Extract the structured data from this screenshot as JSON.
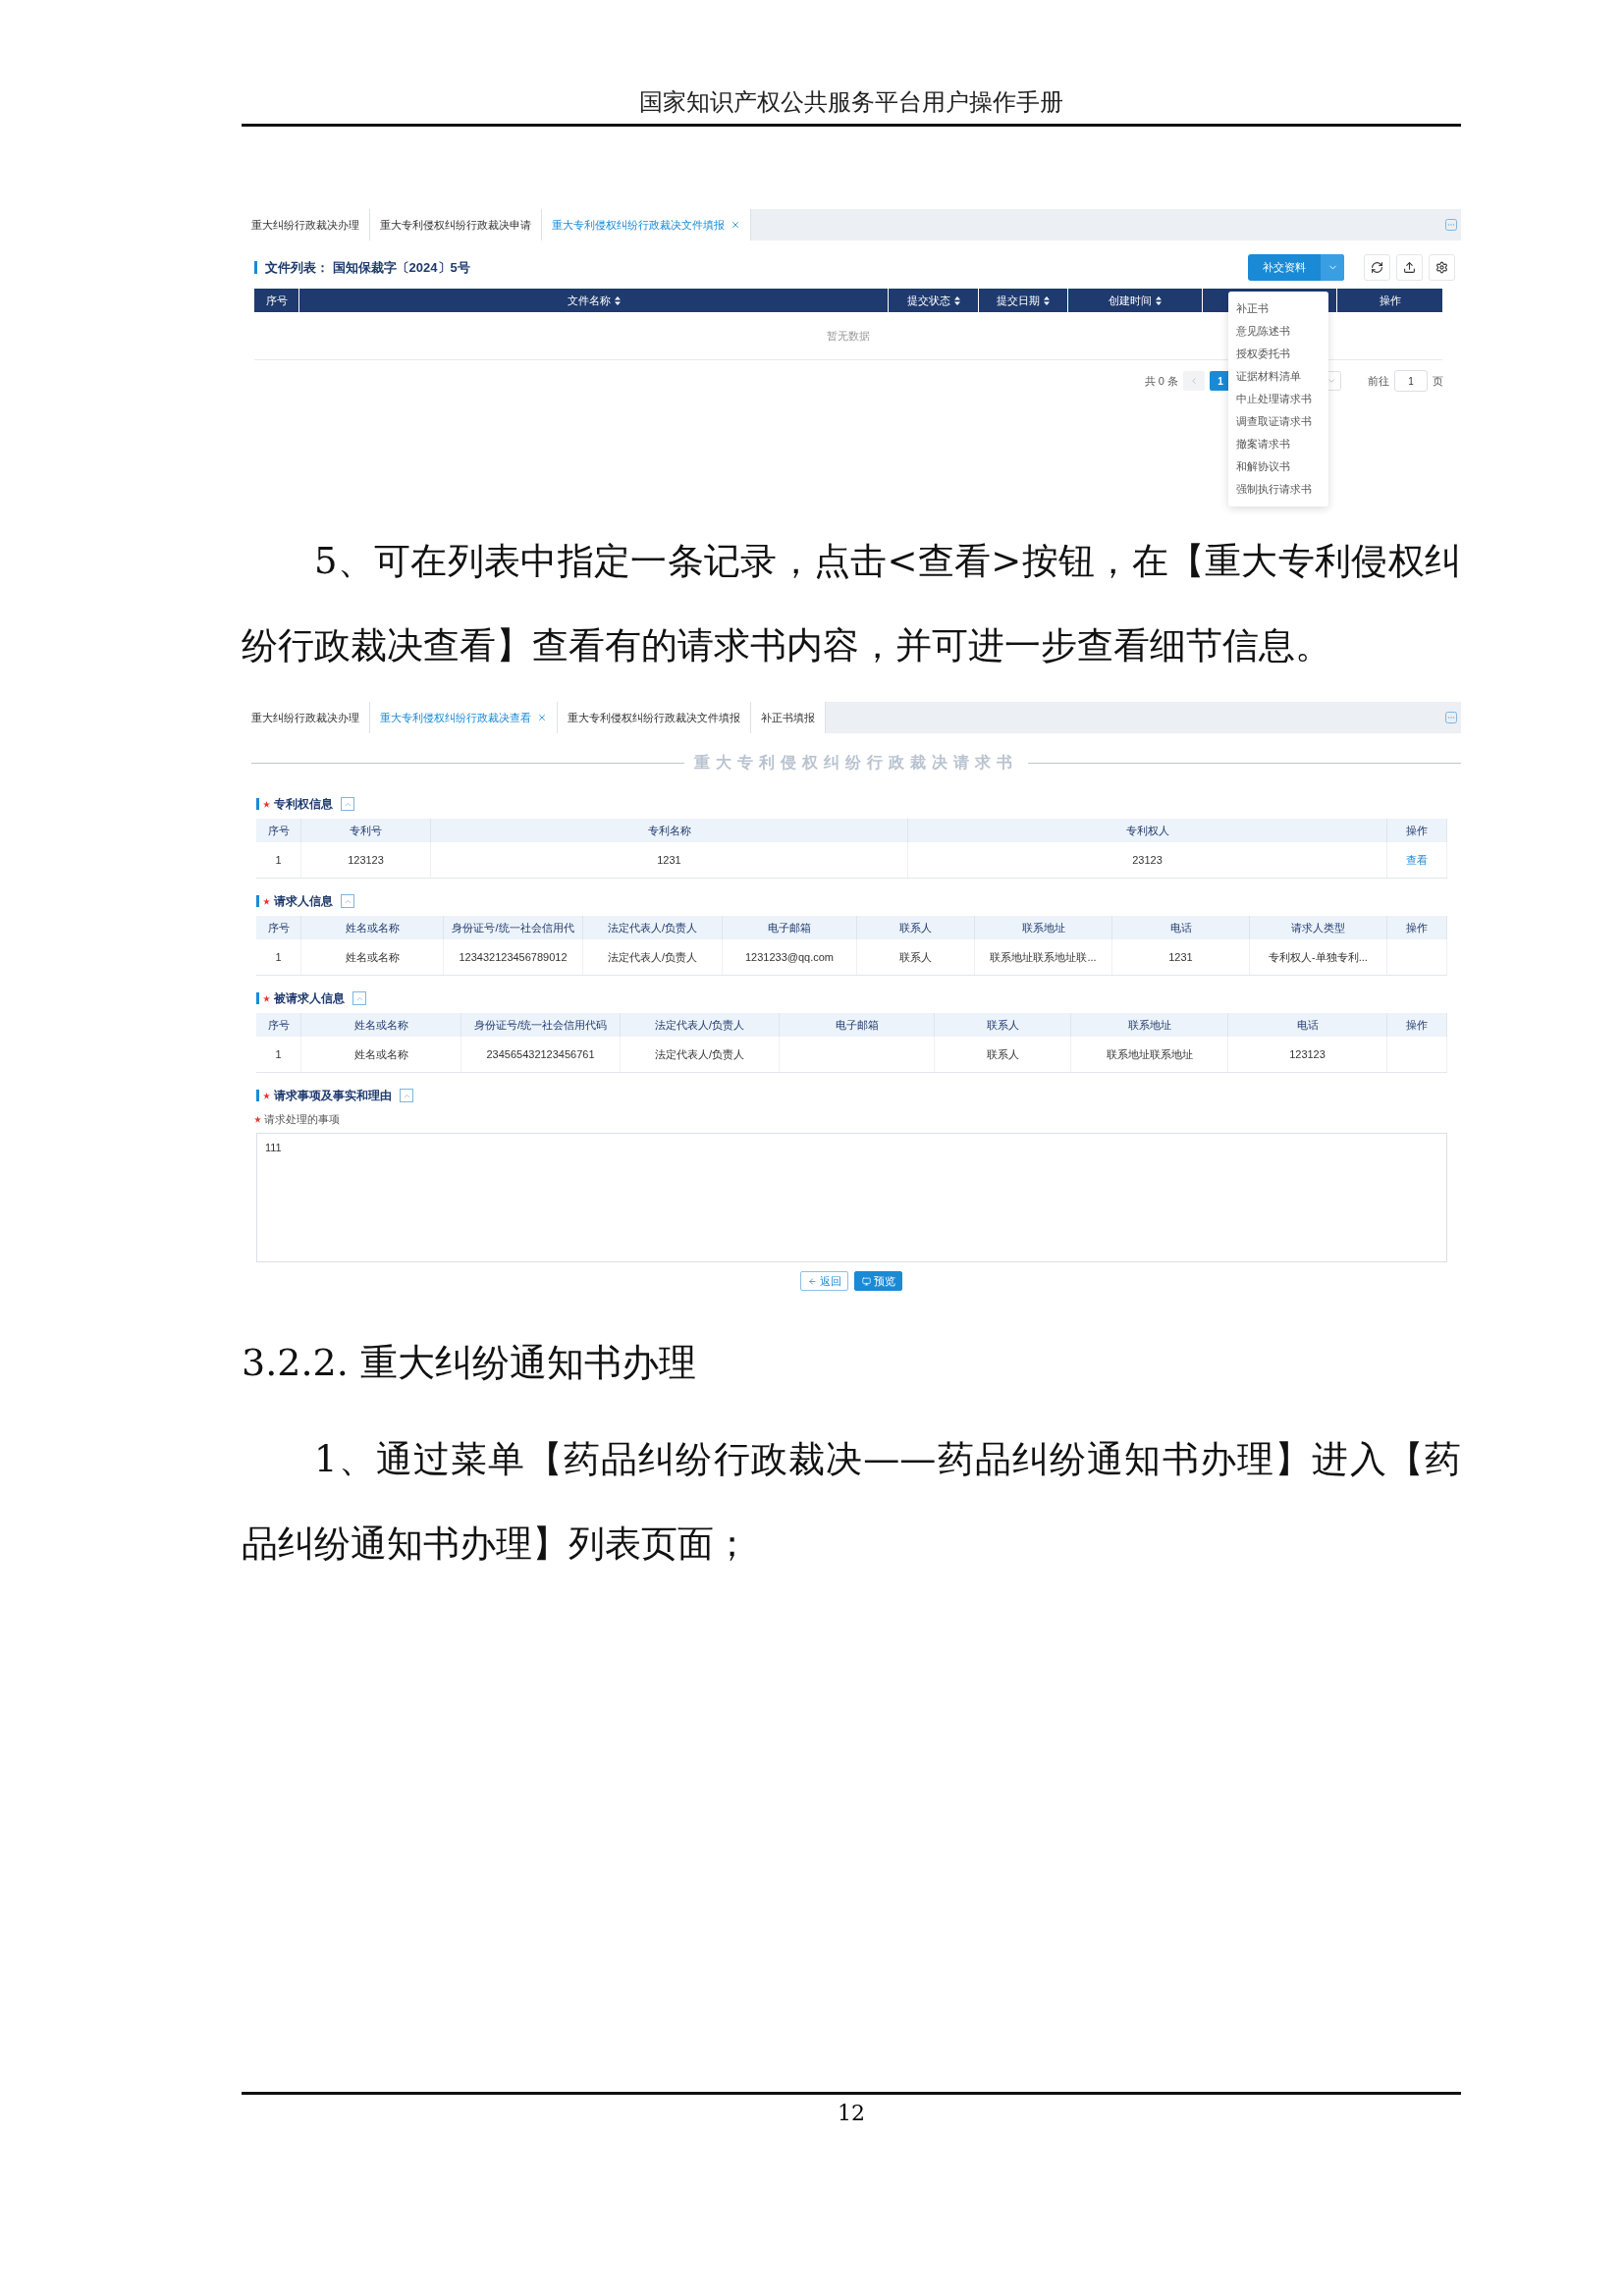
{
  "page_header": "国家知识产权公共服务平台用户操作手册",
  "file_list_screen": {
    "tabs": [
      {
        "label": "重大纠纷行政裁决办理",
        "selected": false
      },
      {
        "label": "重大专利侵权纠纷行政裁决申请",
        "selected": false
      },
      {
        "label": "重大专利侵权纠纷行政裁决文件填报",
        "selected": true
      }
    ],
    "title": "文件列表： 国知保裁字〔2024〕5号",
    "primary_button": "补交资料",
    "columns": [
      {
        "label": "序号",
        "sortable": false
      },
      {
        "label": "文件名称",
        "sortable": true
      },
      {
        "label": "提交状态",
        "sortable": true
      },
      {
        "label": "提交日期",
        "sortable": true
      },
      {
        "label": "创建时间",
        "sortable": true
      },
      {
        "label": "操作",
        "sortable": false
      }
    ],
    "empty_text": "暂无数据",
    "pagination": {
      "total": "共 0 条",
      "pages": [
        {
          "label": "1",
          "selected": true
        }
      ],
      "goto_label": "前往",
      "goto_value": "1",
      "goto_suffix": "页"
    },
    "menu_items": [
      "补正书",
      "意见陈述书",
      "授权委托书",
      "证据材料清单",
      "中止处理请求书",
      "调查取证请求书",
      "撤案请求书",
      "和解协议书",
      "强制执行请求书"
    ]
  },
  "paragraph_1": "5、可在列表中指定一条记录，点击<查看>按钮，在【重大专利侵权纠纷行政裁决查看】查看有的请求书内容，并可进一步查看细节信息。",
  "view_screen": {
    "tabs": [
      {
        "label": "重大纠纷行政裁决办理",
        "selected": false
      },
      {
        "label": "重大专利侵权纠纷行政裁决查看",
        "selected": true
      },
      {
        "label": "重大专利侵权纠纷行政裁决文件填报",
        "selected": false
      },
      {
        "label": "补正书填报",
        "selected": false
      }
    ],
    "form_title": "重大专利侵权纠纷行政裁决请求书",
    "sections": [
      {
        "title": "专利权信息",
        "required": true,
        "table": {
          "columns": [
            "序号",
            "专利号",
            "专利名称",
            "专利权人",
            "操作"
          ],
          "rows": [
            [
              {
                "text": "1"
              },
              {
                "text": "123123"
              },
              {
                "text": "1231"
              },
              {
                "text": "23123"
              },
              {
                "text": "查看",
                "kind": "link"
              }
            ]
          ]
        }
      },
      {
        "title": "请求人信息",
        "required": true,
        "table": {
          "columns": [
            "序号",
            "姓名或名称",
            "身份证号/统一社会信用代",
            "法定代表人/负责人",
            "电子邮箱",
            "联系人",
            "联系地址",
            "电话",
            "请求人类型",
            "操作"
          ],
          "rows": [
            [
              {
                "text": "1"
              },
              {
                "text": "姓名或名称"
              },
              {
                "text": "123432123456789012"
              },
              {
                "text": "法定代表人/负责人"
              },
              {
                "text": "1231233@qq.com"
              },
              {
                "text": "联系人"
              },
              {
                "text": "联系地址联系地址联..."
              },
              {
                "text": "1231"
              },
              {
                "text": "专利权人-单独专利..."
              },
              {}
            ]
          ]
        }
      },
      {
        "title": "被请求人信息",
        "required": true,
        "table": {
          "columns": [
            "序号",
            "姓名或名称",
            "身份证号/统一社会信用代码",
            "法定代表人/负责人",
            "电子邮箱",
            "联系人",
            "联系地址",
            "电话",
            "操作"
          ],
          "rows": [
            [
              {
                "text": "1"
              },
              {
                "text": "姓名或名称"
              },
              {
                "text": "234565432123456761"
              },
              {
                "text": "法定代表人/负责人"
              },
              {},
              {
                "text": "联系人"
              },
              {
                "text": "联系地址联系地址"
              },
              {
                "text": "123123"
              },
              {}
            ]
          ]
        }
      },
      {
        "title": "请求事项及事实和理由",
        "required": true,
        "field": {
          "label": "请求处理的事项",
          "required": true,
          "value": "111"
        }
      }
    ],
    "buttons": [
      {
        "label": "返回",
        "kind": "secondary"
      },
      {
        "label": "预览",
        "kind": "primary"
      }
    ]
  },
  "heading": "3.2.2. 重大纠纷通知书办理",
  "paragraph_2": "1、通过菜单【药品纠纷行政裁决——药品纠纷通知书办理】进入【药品纠纷通知书办理】列表页面；",
  "page_number": "12"
}
